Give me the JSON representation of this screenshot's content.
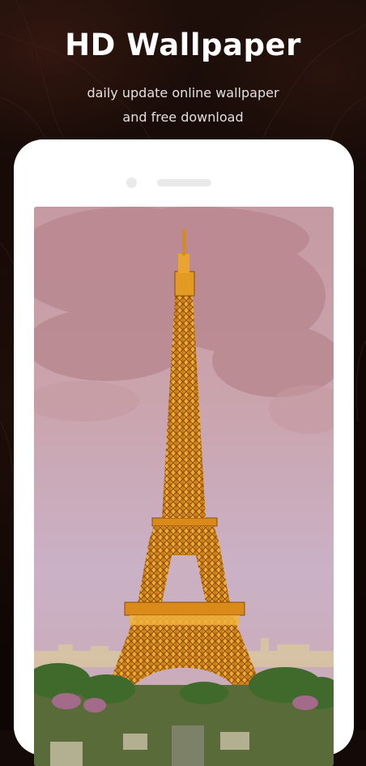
{
  "app": {
    "title": "HD Wallpaper",
    "subtitle_line1": "daily update online wallpaper",
    "subtitle_line2": "and free download"
  },
  "phone": {
    "wallpaper": "eiffel-tower-wallpaper",
    "colors": {
      "sky_top": "#cfa5ac",
      "sky_bottom": "#cbb2c8",
      "tower": "#e0961e",
      "tower_highlight": "#f6c55a",
      "trees": "#3f6a2c"
    }
  }
}
